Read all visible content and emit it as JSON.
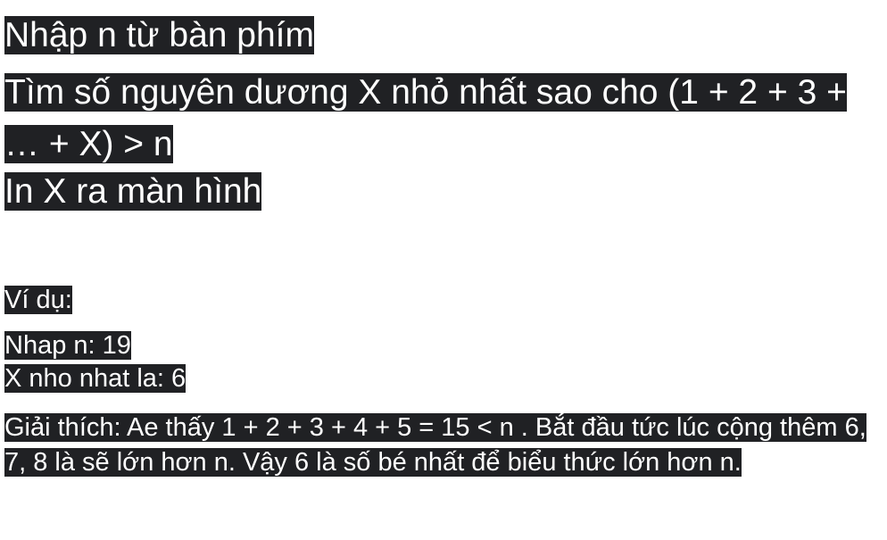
{
  "task": {
    "line1": "Nhập n từ bàn phím",
    "line2": "Tìm số nguyên dương X nhỏ nhất sao cho (1 + 2 + 3 + … + X) > n",
    "line3": "In X ra màn hình"
  },
  "example": {
    "label": "Ví dụ:",
    "input": "Nhap n: 19",
    "output": "X nho nhat la: 6",
    "explanation": "Giải thích: Ae thấy 1 + 2 + 3 + 4 + 5 = 15 < n . Bắt đầu tức lúc cộng thêm 6, 7, 8 là sẽ lớn hơn n. Vậy 6 là số bé nhất để biểu thức lớn hơn n."
  },
  "colors": {
    "highlight_background": "#202124",
    "text": "#ffffff",
    "page_background": "#ffffff"
  }
}
